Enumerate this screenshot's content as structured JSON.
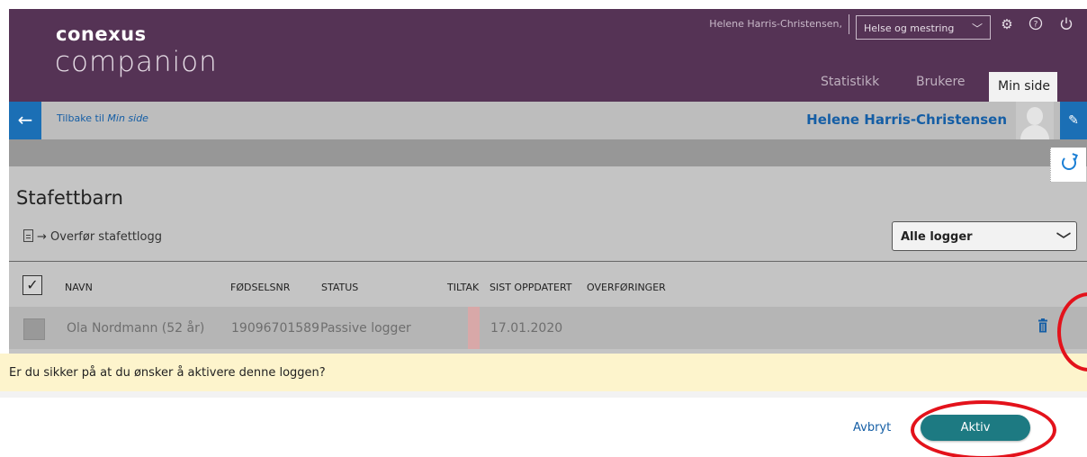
{
  "header": {
    "logo_top": "conexus",
    "logo_bottom": "companion",
    "user_name": "Helene Harris-Christensen,",
    "org_select": "Helse og mestring",
    "tabs": [
      {
        "label": "Statistikk"
      },
      {
        "label": "Brukere"
      },
      {
        "label": "Min side"
      }
    ]
  },
  "subbar": {
    "back_prefix": "Tilbake til",
    "back_target": "Min side",
    "profile_name": "Helene Harris-Christensen"
  },
  "main": {
    "title": "Stafettbarn",
    "transfer_label": "Overfør stafettlogg",
    "filter_value": "Alle logger",
    "columns": [
      "NAVN",
      "FØDSELSNR",
      "STATUS",
      "TILTAK",
      "SIST OPPDATERT",
      "OVERFØRINGER"
    ],
    "row": {
      "name": "Ola Nordmann (52 år)",
      "ssn": "19096701589",
      "status": "Passive logger",
      "updated": "17.01.2020"
    }
  },
  "confirm": {
    "text": "Er du sikker på at du ønsker å aktivere denne loggen?",
    "cancel_label": "Avbryt",
    "aktiv_label": "Aktiv"
  },
  "colors": {
    "header_bg": "#553355",
    "accent_blue": "#1b6fb5",
    "aktiv_button": "#1d7a82",
    "confirm_bg": "#fdf4cc",
    "highlight_red": "#e3121b"
  },
  "icons": [
    "back-arrow-icon",
    "settings-icon",
    "help-icon",
    "power-icon",
    "chevron-down-icon",
    "edit-icon",
    "transfer-icon",
    "trash-icon",
    "restore-icon"
  ]
}
